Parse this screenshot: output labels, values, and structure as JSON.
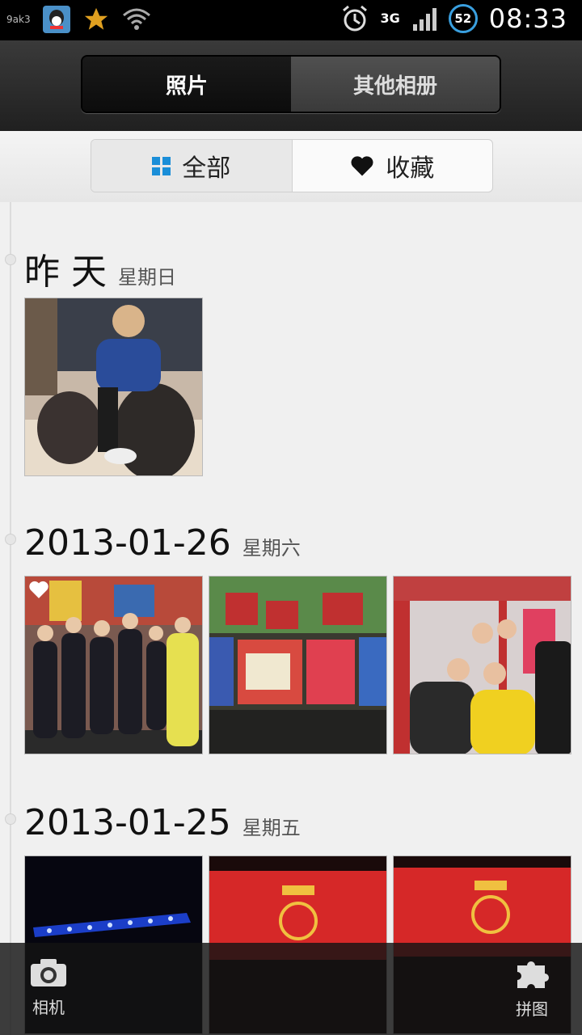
{
  "status_bar": {
    "carrier": "9ak3",
    "network": "3G",
    "battery": "52",
    "time": "08:33"
  },
  "top_tabs": [
    {
      "label": "照片",
      "active": true
    },
    {
      "label": "其他相册",
      "active": false
    }
  ],
  "filter_tabs": {
    "all_label": "全部",
    "favorites_label": "收藏"
  },
  "sections": [
    {
      "date": "昨 天",
      "weekday": "星期日",
      "photos": [
        "person-sitting-in-chair"
      ]
    },
    {
      "date": "2013-01-26",
      "weekday": "星期六",
      "photos": [
        "group-photo-favorited",
        "event-posters-wall",
        "friends-posing"
      ]
    },
    {
      "date": "2013-01-25",
      "weekday": "星期五",
      "photos": [
        "stage-lights",
        "red-stage-backdrop",
        "red-stage-backdrop-2"
      ]
    }
  ],
  "bottom_bar": {
    "camera_label": "相机",
    "collage_label": "拼图"
  },
  "colors": {
    "accent_blue": "#1a8ed8",
    "favorite_red": "#e53935"
  }
}
